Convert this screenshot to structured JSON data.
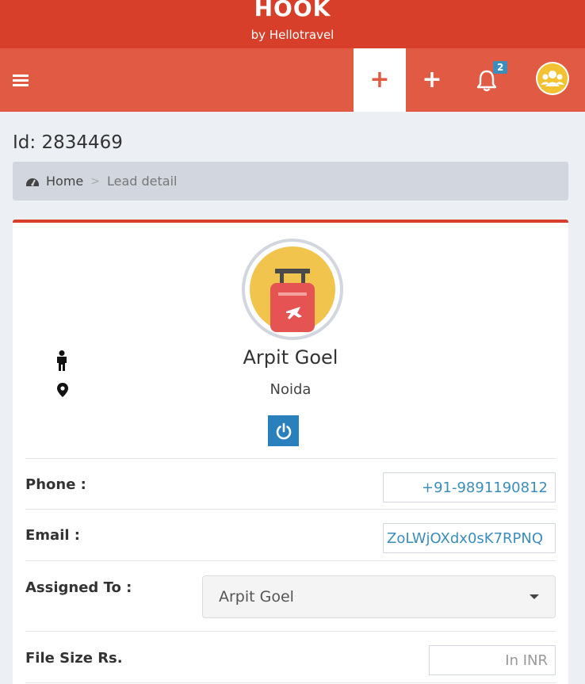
{
  "brand": {
    "title": "HOOK",
    "subtitle": "by Hellotravel"
  },
  "navbar": {
    "add_lead_icon": "plus-icon",
    "add_icon": "plus-icon",
    "notification_count": "2"
  },
  "page": {
    "lead_id": "Id: 2834469"
  },
  "breadcrumb": {
    "home": "Home",
    "separator": ">",
    "current": "Lead detail"
  },
  "lead": {
    "name": "Arpit Goel",
    "city": "Noida"
  },
  "fields": {
    "phone_label": "Phone :",
    "phone_value": "+91-9891190812",
    "email_label": "Email :",
    "email_value": "ZoLWjOXdx0sK7RPNQ",
    "assigned_label": "Assigned To :",
    "assigned_value": "Arpit Goel",
    "file_size_label": "File Size Rs.",
    "file_size_placeholder": "In INR"
  },
  "colors": {
    "brand": "#d73f2a",
    "navbar": "#e05a44",
    "accent": "#3c8dbc",
    "background": "#ecf0f5"
  }
}
